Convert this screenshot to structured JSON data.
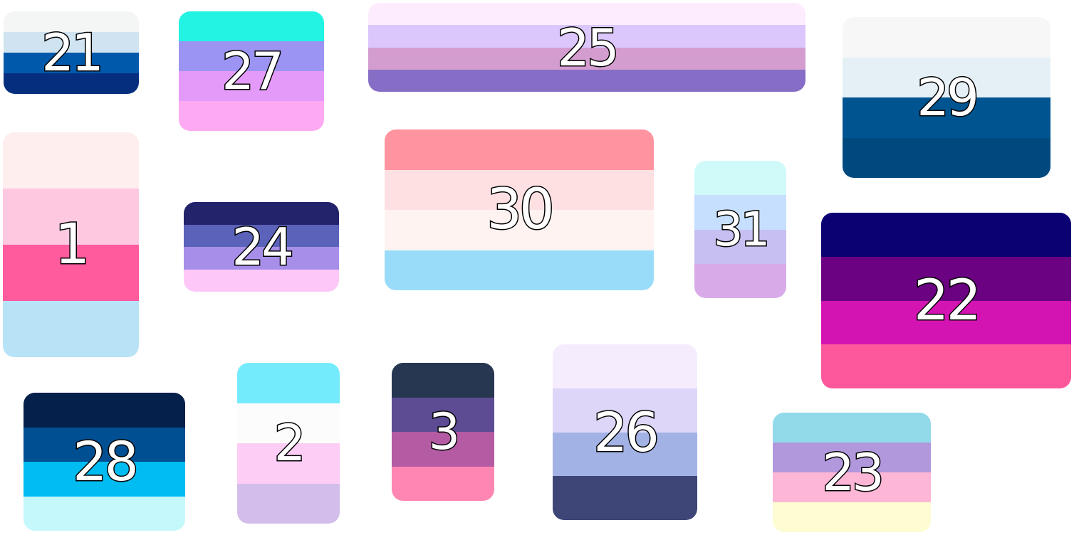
{
  "flags": [
    {
      "id": "21",
      "label": "21",
      "colors": [
        "#f4f6f6",
        "#cfe3f0",
        "#0059ab",
        "#052f7e"
      ]
    },
    {
      "id": "27",
      "label": "27",
      "colors": [
        "#22f3e2",
        "#9c94f2",
        "#e49af9",
        "#feaaf3"
      ]
    },
    {
      "id": "25",
      "label": "25",
      "colors": [
        "#fcecfd",
        "#dbc7fc",
        "#d39dd0",
        "#866ec7"
      ]
    },
    {
      "id": "29",
      "label": "29",
      "colors": [
        "#f7f7f8",
        "#e4f0f6",
        "#005591",
        "#00497f"
      ]
    },
    {
      "id": "1",
      "label": "1",
      "colors": [
        "#feeeee",
        "#fec8e0",
        "#ff5b9d",
        "#b8e3f7"
      ]
    },
    {
      "id": "24",
      "label": "24",
      "colors": [
        "#23236b",
        "#5a62b9",
        "#a78fe9",
        "#fdc8f8"
      ]
    },
    {
      "id": "30",
      "label": "30",
      "colors": [
        "#ff939f",
        "#ffe0e2",
        "#fff3f2",
        "#99dcfa"
      ]
    },
    {
      "id": "31",
      "label": "31",
      "colors": [
        "#cffaf9",
        "#c6dffe",
        "#c7bff1",
        "#d9aae8"
      ]
    },
    {
      "id": "22",
      "label": "22",
      "colors": [
        "#0b0173",
        "#6a0281",
        "#d414b2",
        "#fe589d"
      ]
    },
    {
      "id": "28",
      "label": "28",
      "colors": [
        "#05204a",
        "#004f92",
        "#00bcf1",
        "#c4f8fb"
      ]
    },
    {
      "id": "2",
      "label": "2",
      "colors": [
        "#74ebfc",
        "#fcfcfc",
        "#fecdf5",
        "#d3bdea"
      ]
    },
    {
      "id": "3",
      "label": "3",
      "colors": [
        "#273752",
        "#5d4b93",
        "#b45ba3",
        "#ff86b2"
      ]
    },
    {
      "id": "26",
      "label": "26",
      "colors": [
        "#f5ecfe",
        "#ded6f8",
        "#a3b2e5",
        "#3e4678"
      ]
    },
    {
      "id": "23",
      "label": "23",
      "colors": [
        "#92d9ea",
        "#b198dd",
        "#feb6d7",
        "#fefcd2"
      ]
    }
  ]
}
